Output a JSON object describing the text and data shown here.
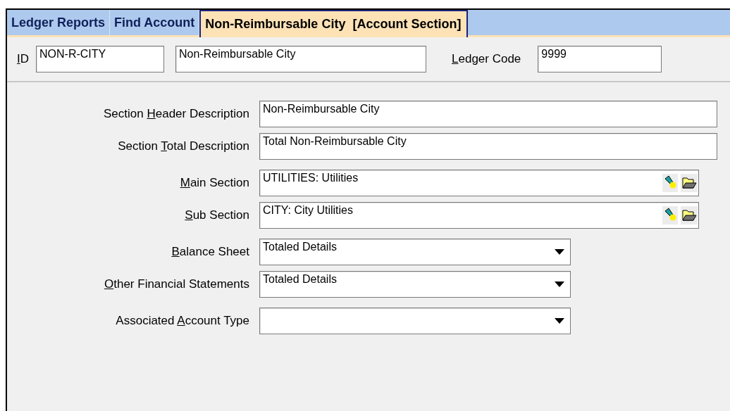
{
  "tabs": [
    {
      "label": "Ledger Reports",
      "selected": false
    },
    {
      "label": "Find Account",
      "selected": false
    },
    {
      "label": "Non-Reimbursable City  [Account Section]",
      "selected": true
    }
  ],
  "header": {
    "id_label": {
      "key": "I",
      "after": "D"
    },
    "id_value": "NON-R-CITY",
    "name_value": "Non-Reimbursable City",
    "ledger_label": {
      "key": "L",
      "after": "edger Code"
    },
    "ledger_value": "9999"
  },
  "groups": [
    [
      {
        "kind": "text",
        "label": {
          "before": "Section ",
          "key": "H",
          "after": "eader Description"
        },
        "value": "Non-Reimbursable City"
      },
      {
        "kind": "text",
        "label": {
          "before": "Section ",
          "key": "T",
          "after": "otal Description"
        },
        "value": "Total Non-Reimbursable City"
      }
    ],
    [
      {
        "kind": "lookup",
        "label": {
          "key": "M",
          "after": "ain Section"
        },
        "value": "UTILITIES: Utilities"
      },
      {
        "kind": "lookup",
        "label": {
          "key": "S",
          "after": "ub Section"
        },
        "value": "CITY: City Utilities"
      }
    ],
    [
      {
        "kind": "dropdown",
        "label": {
          "key": "B",
          "after": "alance Sheet"
        },
        "value": "Totaled Details"
      },
      {
        "kind": "dropdown",
        "label": {
          "key": "O",
          "after": "ther Financial Statements"
        },
        "value": "Totaled Details"
      }
    ],
    [
      {
        "kind": "dropdown",
        "label": {
          "before": "Associated ",
          "key": "A",
          "after": "ccount Type"
        }
      }
    ]
  ]
}
